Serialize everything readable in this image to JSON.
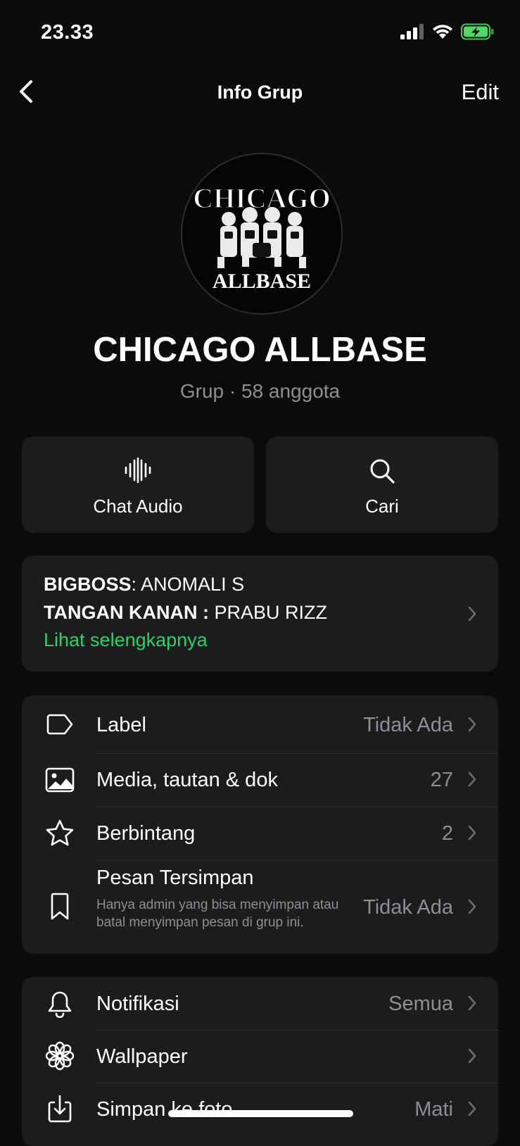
{
  "status_bar": {
    "time": "23.33",
    "icons": [
      "signal-icon",
      "wifi-icon",
      "battery-charging-icon"
    ]
  },
  "nav": {
    "back_icon": "chevron-left-icon",
    "title": "Info Grup",
    "edit_label": "Edit"
  },
  "group": {
    "avatar_text_top": "CHICAGO",
    "avatar_text_bottom": "ALLBASE",
    "name": "CHICAGO ALLBASE",
    "subtitle": "Grup · 58 anggota"
  },
  "actions": [
    {
      "label": "Chat Audio",
      "icon": "audio-waveform-icon"
    },
    {
      "label": "Cari",
      "icon": "search-icon"
    }
  ],
  "description": {
    "line1_bold": "BIGBOSS",
    "line1_rest": ": ANOMALI S",
    "line2_bold": "TANGAN KANAN :",
    "line2_rest": " PRABU RIZZ",
    "more_link": "Lihat selengkapnya"
  },
  "settings_group1": [
    {
      "icon": "label-tag-icon",
      "label": "Label",
      "value": "Tidak Ada"
    },
    {
      "icon": "media-image-icon",
      "label": "Media, tautan & dok",
      "value": "27"
    },
    {
      "icon": "star-icon",
      "label": "Berbintang",
      "value": "2"
    },
    {
      "icon": "bookmark-icon",
      "label": "Pesan Tersimpan",
      "value": "Tidak Ada",
      "subtext": "Hanya admin yang bisa menyimpan atau batal menyimpan pesan di grup ini."
    }
  ],
  "settings_group2": [
    {
      "icon": "bell-icon",
      "label": "Notifikasi",
      "value": "Semua"
    },
    {
      "icon": "wallpaper-flower-icon",
      "label": "Wallpaper",
      "value": ""
    },
    {
      "icon": "save-download-icon",
      "label": "Simpan ke foto",
      "value": "Mati"
    }
  ],
  "colors": {
    "background": "#0b0b0b",
    "card": "#1c1c1e",
    "secondary_text": "#8e8e93",
    "accent_green": "#25d366"
  }
}
